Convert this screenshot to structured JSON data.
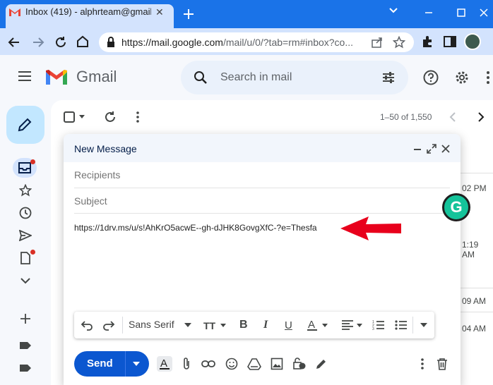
{
  "browser": {
    "tab_title": "Inbox (419) - alphrteam@gmail.c",
    "url_host": "https://mail.google.com",
    "url_rest": "/mail/u/0/?tab=rm#inbox?co..."
  },
  "gmail": {
    "wordmark": "Gmail",
    "search_placeholder": "Search in mail",
    "pagination": "1–50 of 1,550",
    "times": [
      "02 PM",
      "1:19 AM",
      "09 AM",
      "04 AM"
    ]
  },
  "compose": {
    "title": "New Message",
    "recipients_placeholder": "Recipients",
    "subject_placeholder": "Subject",
    "body": "https://1drv.ms/u/s!AhKrO5acwE--gh-dJHK8GovgXfC-?e=Thesfa",
    "font": "Sans Serif",
    "send_label": "Send"
  },
  "colors": {
    "chrome_accent": "#1a73e8",
    "send_button": "#0b57d0",
    "annotation_arrow": "#e8001c",
    "grammarly": "#15c39a"
  },
  "icons": [
    "gmail-logo-icon",
    "close-icon",
    "plus-icon",
    "minimize-icon",
    "maximize-icon",
    "back-icon",
    "forward-icon",
    "reload-icon",
    "home-icon",
    "lock-icon",
    "share-icon",
    "star-icon",
    "extensions-icon",
    "sidebar-icon",
    "profile-icon",
    "menu-icon",
    "search-icon",
    "filter-icon",
    "help-icon",
    "settings-icon",
    "pencil-icon",
    "inbox-icon",
    "clock-icon",
    "send-icon",
    "draft-icon",
    "chevron-down-icon",
    "label-icon",
    "checkbox-icon",
    "refresh-icon",
    "more-icon",
    "undo-icon",
    "redo-icon",
    "bold-icon",
    "italic-icon",
    "underline-icon",
    "text-color-icon",
    "align-icon",
    "numbered-list-icon",
    "bulleted-list-icon",
    "attach-icon",
    "link-icon",
    "emoji-icon",
    "drive-icon",
    "photo-icon",
    "confidential-icon",
    "signature-icon",
    "trash-icon",
    "grammarly-icon",
    "red-arrow-icon"
  ]
}
